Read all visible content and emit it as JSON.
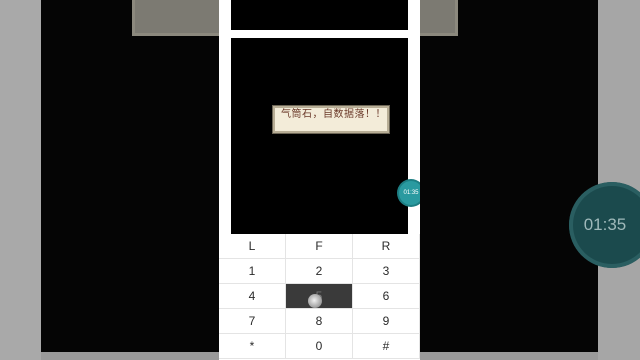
{
  "background": {
    "timer_text": "01:35"
  },
  "game": {
    "dialog_text": "气筒石，自数据落！！！"
  },
  "overlay": {
    "timer_text": "01:35"
  },
  "keypad": {
    "rows": [
      [
        "L",
        "F",
        "R"
      ],
      [
        "1",
        "2",
        "3"
      ],
      [
        "4",
        "5",
        "6"
      ],
      [
        "7",
        "8",
        "9"
      ],
      [
        "*",
        "0",
        "#"
      ]
    ],
    "pressed_key": "5"
  },
  "colors": {
    "timer_accent": "#2a9aa0",
    "dialog_bg": "#f3ecd9",
    "pressed_key_bg": "#3a3a3a"
  }
}
